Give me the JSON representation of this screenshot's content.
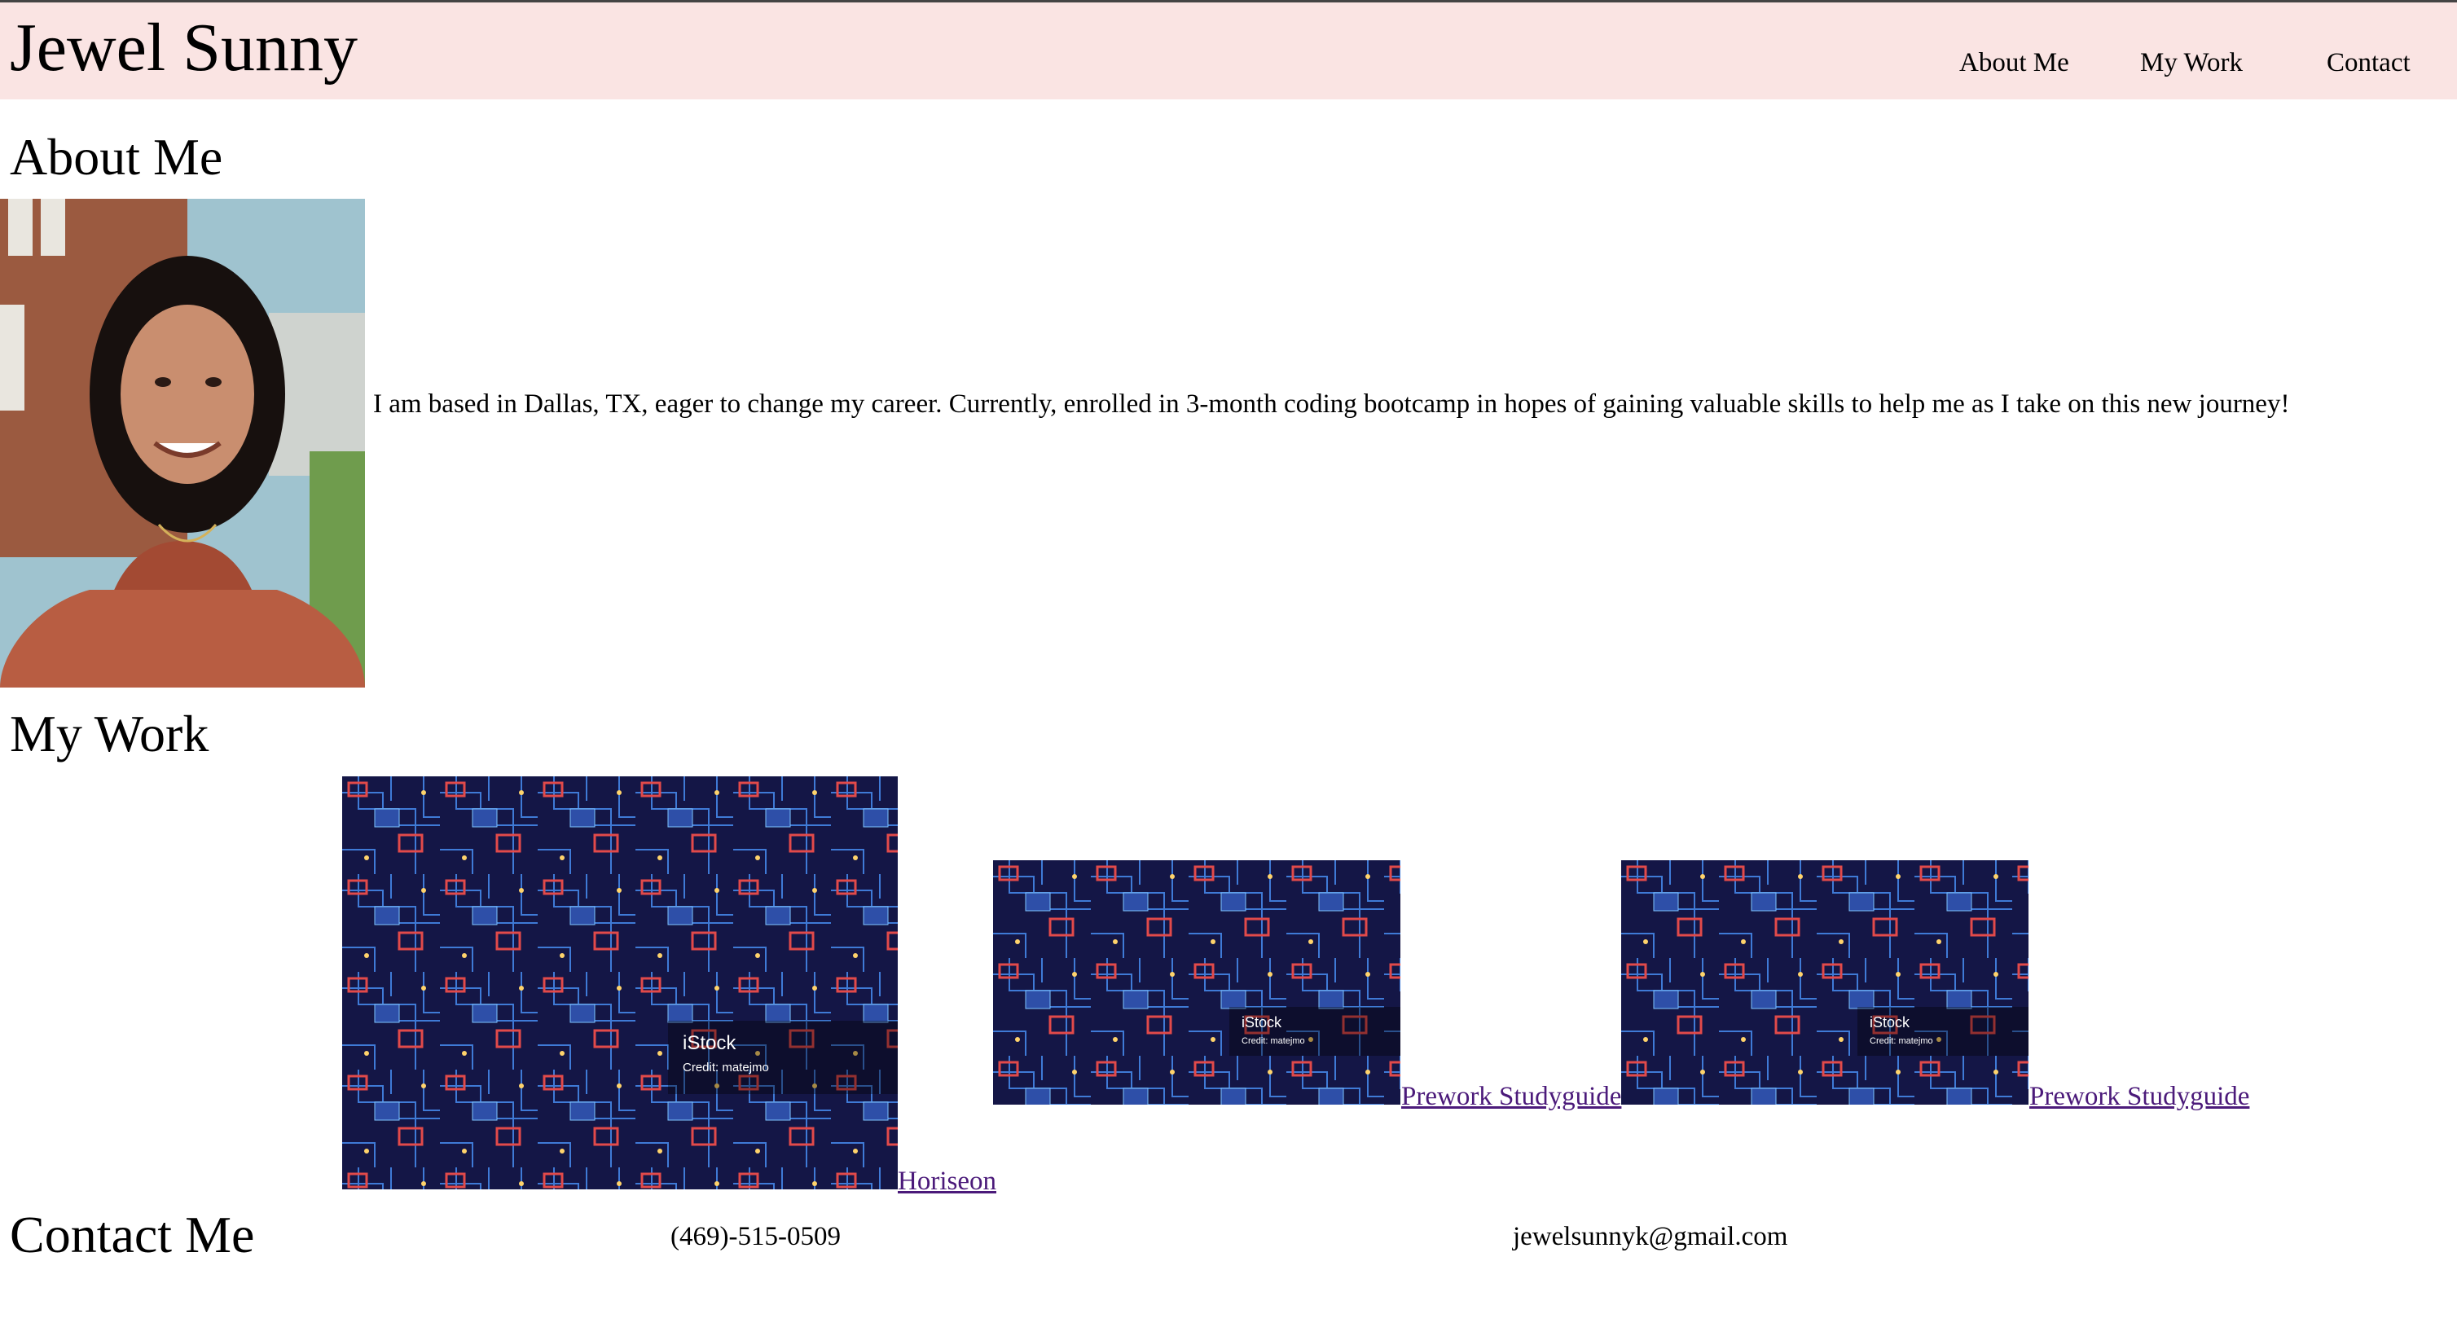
{
  "header": {
    "title": "Jewel Sunny",
    "nav": [
      "About Me",
      "My Work",
      "Contact"
    ],
    "background_color": "#fae4e3"
  },
  "about": {
    "heading": "About Me",
    "portrait_icon": "profile-photo",
    "text": "I am based in Dallas, TX, eager to change my career. Currently, enrolled in 3-month coding bootcamp in hopes of gaining valuable skills to help me as I take on this new journey!"
  },
  "work": {
    "heading": "My Work",
    "items": [
      {
        "link_text": "Horiseon",
        "image_icon": "circuit-board-image",
        "watermark": "iStock",
        "credit": "Credit: matejmo"
      },
      {
        "link_text": "Prework Studyguide ",
        "image_icon": "circuit-board-image",
        "watermark": "iStock",
        "credit": "Credit: matejmo"
      },
      {
        "link_text": " Prework Studyguide",
        "image_icon": "circuit-board-image",
        "watermark": "iStock",
        "credit": "Credit: matejmo"
      }
    ],
    "link_color": "#4b1a7a"
  },
  "contact": {
    "heading": "Contact Me",
    "phone": "(469)-515-0509",
    "email": "jewelsunnyk@gmail.com"
  }
}
